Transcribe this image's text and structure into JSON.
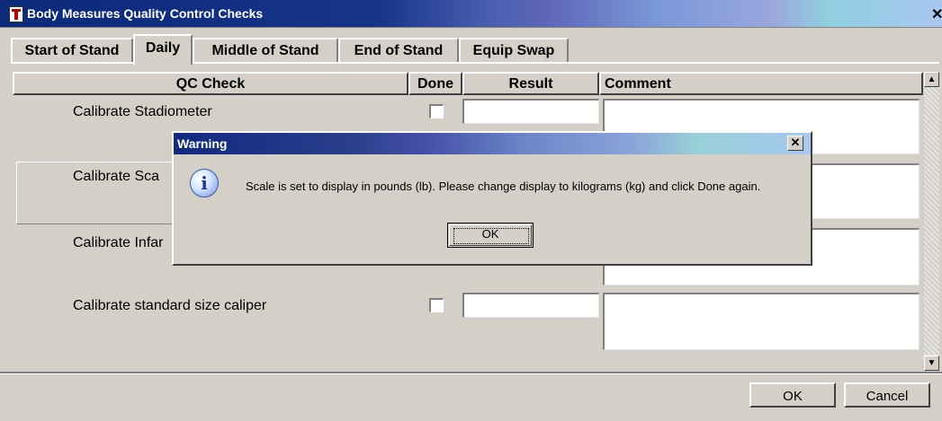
{
  "window": {
    "title": "Body Measures Quality Control Checks",
    "close_label": "✕"
  },
  "tabs": [
    {
      "label": "Start of Stand",
      "active": false
    },
    {
      "label": "Daily",
      "active": true
    },
    {
      "label": "Middle of Stand",
      "active": false
    },
    {
      "label": "End of Stand",
      "active": false
    },
    {
      "label": "Equip Swap",
      "active": false
    }
  ],
  "grid": {
    "columns": [
      "QC Check",
      "Done",
      "Result",
      "Comment"
    ],
    "rows": [
      {
        "check": "Calibrate Stadiometer",
        "done": false,
        "result": "",
        "comment": ""
      },
      {
        "check": "Calibrate Sca",
        "done": false,
        "result": "",
        "comment": ""
      },
      {
        "check": "Calibrate Infar",
        "done": false,
        "result": "",
        "comment": ""
      },
      {
        "check": "Calibrate standard size caliper",
        "done": false,
        "result": "",
        "comment": ""
      }
    ]
  },
  "footer": {
    "ok_label": "OK",
    "cancel_label": "Cancel"
  },
  "dialog": {
    "title": "Warning",
    "close_label": "✕",
    "icon": "information-icon",
    "message": "Scale is set to display in pounds (lb).  Please change display to kilograms (kg) and click Done again.",
    "ok_label": "OK"
  }
}
